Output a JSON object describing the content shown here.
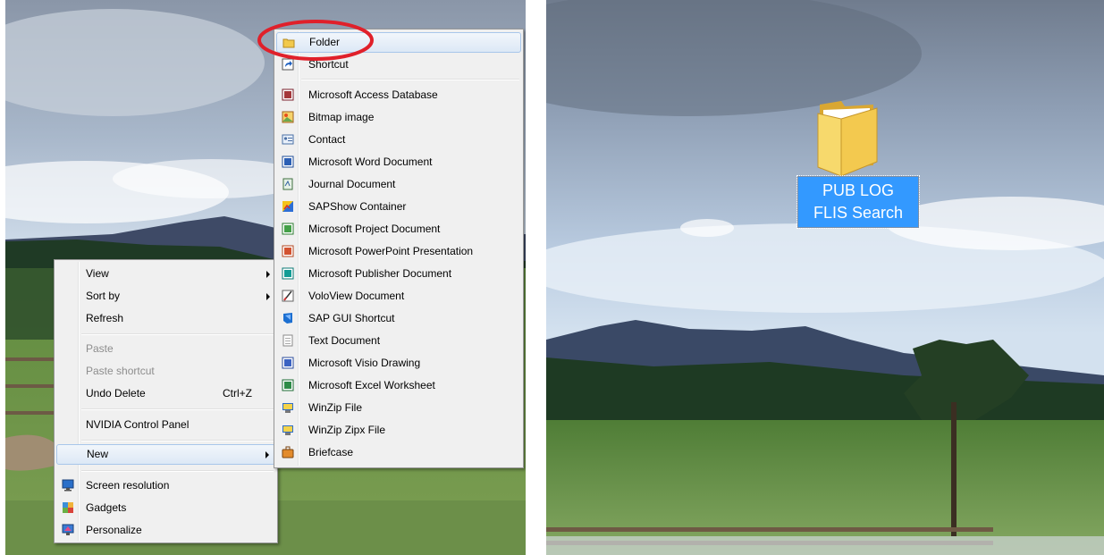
{
  "context_menu": {
    "items": [
      {
        "label": "View",
        "submenu": true
      },
      {
        "label": "Sort by",
        "submenu": true
      },
      {
        "label": "Refresh"
      },
      {
        "label": "Paste",
        "disabled": true
      },
      {
        "label": "Paste shortcut",
        "disabled": true
      },
      {
        "label": "Undo Delete",
        "shortcut": "Ctrl+Z"
      },
      {
        "label": "NVIDIA Control Panel"
      },
      {
        "label": "New",
        "submenu": true,
        "highlighted": true
      },
      {
        "label": "Screen resolution",
        "icon": "screen-resolution-icon"
      },
      {
        "label": "Gadgets",
        "icon": "gadgets-icon"
      },
      {
        "label": "Personalize",
        "icon": "personalize-icon"
      }
    ]
  },
  "new_submenu": {
    "items": [
      {
        "label": "Folder",
        "icon": "folder-icon",
        "highlighted": true
      },
      {
        "label": "Shortcut",
        "icon": "shortcut-icon"
      },
      {
        "label": "Microsoft Access Database",
        "icon": "access-icon"
      },
      {
        "label": "Bitmap image",
        "icon": "bitmap-icon"
      },
      {
        "label": "Contact",
        "icon": "contact-icon"
      },
      {
        "label": "Microsoft Word Document",
        "icon": "word-icon"
      },
      {
        "label": "Journal Document",
        "icon": "journal-icon"
      },
      {
        "label": "SAPShow Container",
        "icon": "sapshow-icon"
      },
      {
        "label": "Microsoft Project Document",
        "icon": "project-icon"
      },
      {
        "label": "Microsoft PowerPoint Presentation",
        "icon": "powerpoint-icon"
      },
      {
        "label": "Microsoft Publisher Document",
        "icon": "publisher-icon"
      },
      {
        "label": "VoloView Document",
        "icon": "voloview-icon"
      },
      {
        "label": "SAP GUI Shortcut",
        "icon": "sap-gui-icon"
      },
      {
        "label": "Text Document",
        "icon": "text-document-icon"
      },
      {
        "label": "Microsoft Visio Drawing",
        "icon": "visio-icon"
      },
      {
        "label": "Microsoft Excel Worksheet",
        "icon": "excel-icon"
      },
      {
        "label": "WinZip File",
        "icon": "winzip-icon"
      },
      {
        "label": "WinZip Zipx File",
        "icon": "winzip-zipx-icon"
      },
      {
        "label": "Briefcase",
        "icon": "briefcase-icon"
      }
    ]
  },
  "desktop_folder": {
    "label_line1": "PUB LOG",
    "label_line2": "FLIS Search"
  },
  "colors": {
    "selection": "#3399ff",
    "annotation_circle": "#e0202a",
    "menu_background": "#f0f0f0"
  }
}
